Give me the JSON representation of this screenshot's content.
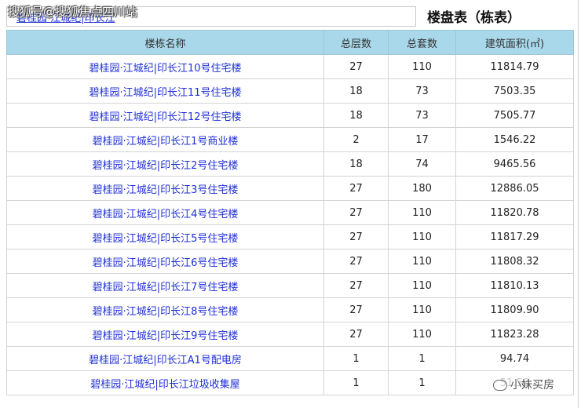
{
  "watermark": "搜狐号@搜狐焦点四川站",
  "project_link": "碧桂园·江城纪|印长江",
  "title": "楼盘表（栋表）",
  "table": {
    "headers": [
      "楼栋名称",
      "总层数",
      "总套数",
      "建筑面积(㎡)"
    ],
    "rows": [
      {
        "name": "碧桂园·江城纪|印长江10号住宅楼",
        "floors": "27",
        "units": "110",
        "area": "11814.79"
      },
      {
        "name": "碧桂园·江城纪|印长江11号住宅楼",
        "floors": "18",
        "units": "73",
        "area": "7503.35"
      },
      {
        "name": "碧桂园·江城纪|印长江12号住宅楼",
        "floors": "18",
        "units": "73",
        "area": "7505.77"
      },
      {
        "name": "碧桂园·江城纪|印长江1号商业楼",
        "floors": "2",
        "units": "17",
        "area": "1546.22"
      },
      {
        "name": "碧桂园·江城纪|印长江2号住宅楼",
        "floors": "18",
        "units": "74",
        "area": "9465.56"
      },
      {
        "name": "碧桂园·江城纪|印长江3号住宅楼",
        "floors": "27",
        "units": "180",
        "area": "12886.05"
      },
      {
        "name": "碧桂园·江城纪|印长江4号住宅楼",
        "floors": "27",
        "units": "110",
        "area": "11820.78"
      },
      {
        "name": "碧桂园·江城纪|印长江5号住宅楼",
        "floors": "27",
        "units": "110",
        "area": "11817.29"
      },
      {
        "name": "碧桂园·江城纪|印长江6号住宅楼",
        "floors": "27",
        "units": "110",
        "area": "11808.32"
      },
      {
        "name": "碧桂园·江城纪|印长江7号住宅楼",
        "floors": "27",
        "units": "110",
        "area": "11810.13"
      },
      {
        "name": "碧桂园·江城纪|印长江8号住宅楼",
        "floors": "27",
        "units": "110",
        "area": "11809.90"
      },
      {
        "name": "碧桂园·江城纪|印长江9号住宅楼",
        "floors": "27",
        "units": "110",
        "area": "11823.28"
      },
      {
        "name": "碧桂园·江城纪|印长江A1号配电房",
        "floors": "1",
        "units": "1",
        "area": "94.74"
      },
      {
        "name": "碧桂园·江城纪|印长江垃圾收集屋",
        "floors": "1",
        "units": "1",
        "area": "51.58"
      }
    ]
  },
  "wechat_label": "小妹买房",
  "link_color": "#1f2fd6",
  "header_color": "#a9d8ea"
}
